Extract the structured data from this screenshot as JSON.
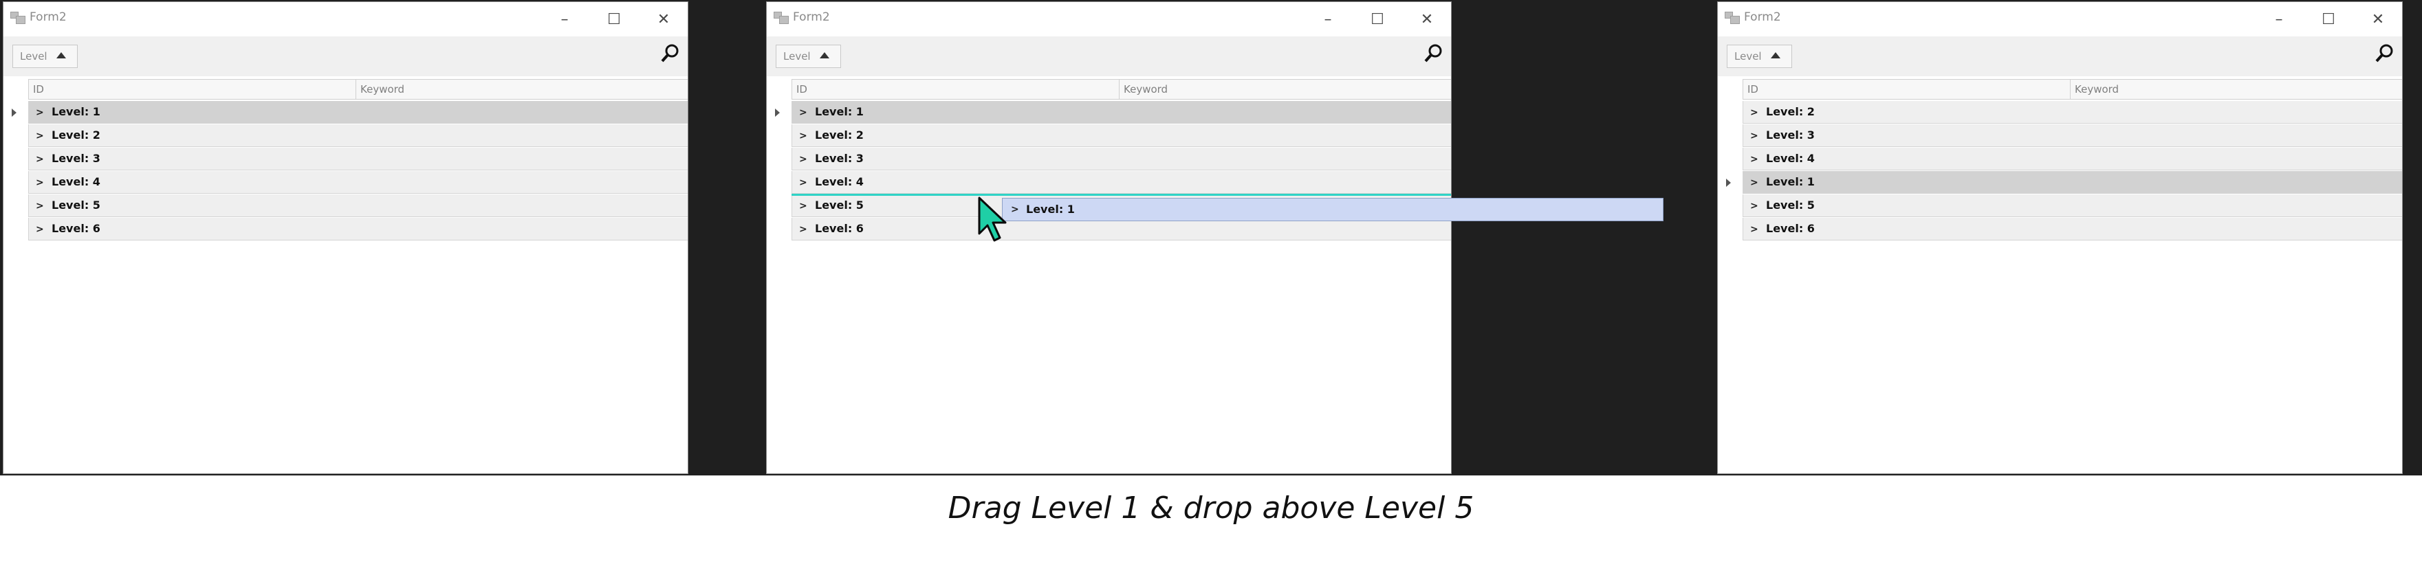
{
  "windows": [
    {
      "title": "Form2",
      "dropdown_label": "Level",
      "columns": [
        "ID",
        "Keyword"
      ],
      "rows": [
        {
          "label": "Level: 1",
          "selected": true
        },
        {
          "label": "Level: 2",
          "selected": false
        },
        {
          "label": "Level: 3",
          "selected": false
        },
        {
          "label": "Level: 4",
          "selected": false
        },
        {
          "label": "Level: 5",
          "selected": false
        },
        {
          "label": "Level: 6",
          "selected": false
        }
      ]
    },
    {
      "title": "Form2",
      "dropdown_label": "Level",
      "columns": [
        "ID",
        "Keyword"
      ],
      "rows": [
        {
          "label": "Level: 1",
          "selected": true
        },
        {
          "label": "Level: 2",
          "selected": false
        },
        {
          "label": "Level: 3",
          "selected": false
        },
        {
          "label": "Level: 4",
          "selected": false
        },
        {
          "label": "Level: 5",
          "selected": false
        },
        {
          "label": "Level: 6",
          "selected": false
        }
      ],
      "drag_ghost_label": "Level: 1"
    },
    {
      "title": "Form2",
      "dropdown_label": "Level",
      "columns": [
        "ID",
        "Keyword"
      ],
      "rows": [
        {
          "label": "Level: 2",
          "selected": false
        },
        {
          "label": "Level: 3",
          "selected": false
        },
        {
          "label": "Level: 4",
          "selected": false
        },
        {
          "label": "Level: 1",
          "selected": true
        },
        {
          "label": "Level: 5",
          "selected": false
        },
        {
          "label": "Level: 6",
          "selected": false
        }
      ]
    }
  ],
  "caption": "Drag Level 1 & drop above Level 5",
  "colors": {
    "selected_row": "#d2d2d2",
    "row": "#efefef",
    "drop_indicator": "#2fd3c6",
    "drag_ghost": "#cdd8f4",
    "cursor": "#1fcfa6"
  }
}
